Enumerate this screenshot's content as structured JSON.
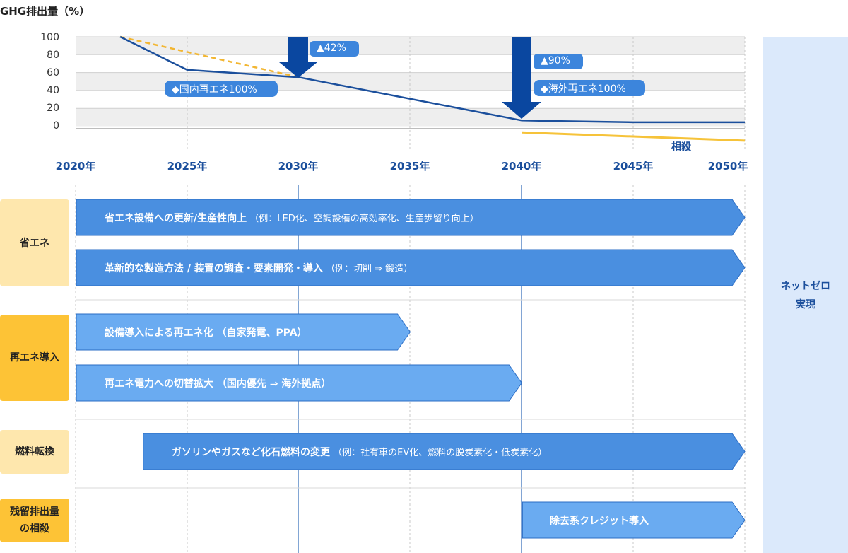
{
  "chart": {
    "y_axis_title": "GHG排出量（%）",
    "y_ticks": [
      "100",
      "80",
      "60",
      "40",
      "20",
      "0"
    ],
    "x_ticks": [
      "2020年",
      "2025年",
      "2030年",
      "2035年",
      "2040年",
      "2045年",
      "2050年"
    ],
    "badges": {
      "reduction_2030": "▲42%",
      "reduction_2040": "▲90%",
      "domestic_renewable": "◆国内再エネ100%",
      "overseas_renewable": "◆海外再エネ100%"
    },
    "offset_label": "相殺"
  },
  "chart_data": {
    "type": "line",
    "ylim": [
      0,
      100
    ],
    "series": [
      {
        "x": [
          2022,
          2025,
          2030,
          2040,
          2045,
          2050
        ],
        "values": [
          100,
          64,
          56,
          9,
          7,
          7
        ]
      },
      {
        "x": [
          2022,
          2030
        ],
        "values": [
          100,
          56
        ]
      },
      {
        "x": [
          2040,
          2050
        ],
        "values": [
          -4,
          -13
        ]
      }
    ]
  },
  "categories": [
    {
      "label": "省エネ"
    },
    {
      "label": "再エネ導入"
    },
    {
      "label": "燃料転換"
    },
    {
      "label": "残留排出量\nの相殺"
    }
  ],
  "bars": [
    {
      "title": "省エネ設備への更新/生産性向上",
      "note": "（例：LED化、空調設備の高効率化、生産歩留り向上）",
      "start": 2020,
      "end": 2050
    },
    {
      "title": "革新的な製造方法 / 装置の調査・要素開発・導入",
      "note": "（例：切削 ⇒ 鍛造）",
      "start": 2020,
      "end": 2050
    },
    {
      "title": "設備導入による再エネ化 （自家発電、PPA）",
      "note": "",
      "start": 2020,
      "end": 2035
    },
    {
      "title": "再エネ電力への切替拡大 （国内優先 ⇒ 海外拠点）",
      "note": "",
      "start": 2020,
      "end": 2040
    },
    {
      "title": "ガソリンやガスなど化石燃料の変更",
      "note": "（例：社有車のEV化、燃料の脱炭素化・低炭素化）",
      "start": 2023,
      "end": 2050
    },
    {
      "title": "除去系クレジット導入",
      "note": "",
      "start": 2040,
      "end": 2050
    }
  ],
  "net_zero": "ネットゼロ\n実現",
  "colors": {
    "dark_navy": "#1b4f9c",
    "arrow_blue": "#0a47a0",
    "bar_blue": "#4a8fe0",
    "bar_light_blue": "#6aabf1",
    "badge_blue": "#3c85dc",
    "dashed_orange": "#f2b632",
    "offset_yellow": "#f6c33a",
    "net_zero_panel": "#dbe9fb",
    "category_light": "#fee7ad",
    "category_dark": "#fdc336"
  }
}
